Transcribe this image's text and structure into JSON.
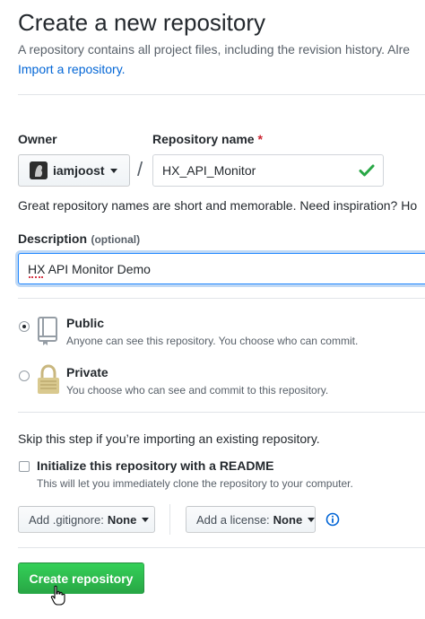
{
  "header": {
    "title": "Create a new repository",
    "subtitle": "A repository contains all project files, including the revision history. Alre",
    "import_link": "Import a repository."
  },
  "owner": {
    "label": "Owner",
    "value": "iamjoost"
  },
  "repo_name": {
    "label": "Repository name",
    "required_mark": "*",
    "value": "HX_API_Monitor",
    "valid_icon": "check-icon"
  },
  "separator": "/",
  "name_hint": "Great repository names are short and memorable. Need inspiration? Ho",
  "description": {
    "label": "Description",
    "optional": "(optional)",
    "value": "HX API Monitor Demo"
  },
  "visibility": {
    "public": {
      "title": "Public",
      "desc": "Anyone can see this repository. You choose who can commit.",
      "icon": "repo-icon",
      "checked": true
    },
    "private": {
      "title": "Private",
      "desc": "You choose who can see and commit to this repository.",
      "icon": "lock-icon",
      "checked": false
    }
  },
  "skip_text": "Skip this step if you’re importing an existing repository.",
  "readme": {
    "label": "Initialize this repository with a README",
    "desc": "This will let you immediately clone the repository to your computer."
  },
  "gitignore": {
    "label": "Add .gitignore:",
    "value": "None"
  },
  "license": {
    "label": "Add a license:",
    "value": "None"
  },
  "info_icon": "info-icon",
  "submit": {
    "label": "Create repository"
  },
  "colors": {
    "link": "#0366d6",
    "success": "#28a745",
    "focus": "#2188ff"
  }
}
